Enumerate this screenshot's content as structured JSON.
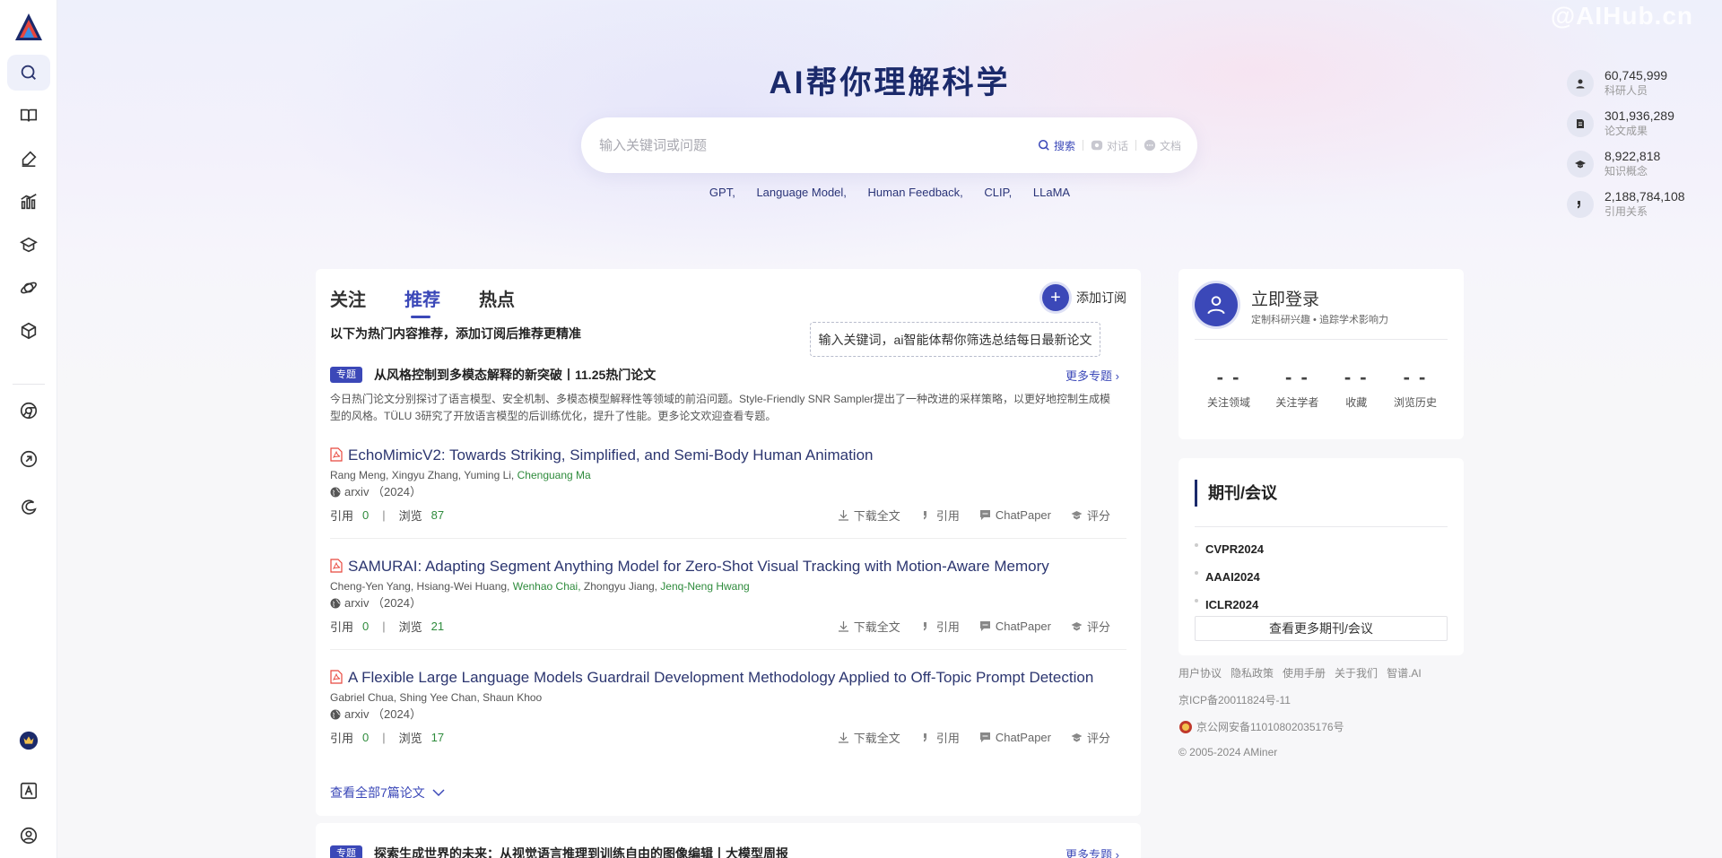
{
  "watermark": "@AIHub.cn",
  "hero": {
    "title": "AI帮你理解科学",
    "search_placeholder": "输入关键词或问题",
    "actions": [
      "搜索",
      "对话",
      "文档"
    ],
    "hot_tags": [
      "GPT,",
      "Language Model,",
      "Human Feedback,",
      "CLIP,",
      "LLaMA"
    ]
  },
  "stats": [
    {
      "value": "60,745,999",
      "label": "科研人员",
      "icon": "person-icon"
    },
    {
      "value": "301,936,289",
      "label": "论文成果",
      "icon": "document-icon"
    },
    {
      "value": "8,922,818",
      "label": "知识概念",
      "icon": "graduation-cap-icon"
    },
    {
      "value": "2,188,784,108",
      "label": "引用关系",
      "icon": "quote-icon"
    }
  ],
  "tabs": [
    "关注",
    "推荐",
    "热点"
  ],
  "active_tab": "推荐",
  "subscribe": {
    "label": "添加订阅",
    "tip": "输入关键词，ai智能体帮你筛选总结每日最新论文"
  },
  "hint": "以下为热门内容推荐，添加订阅后推荐更精准",
  "topic": {
    "badge": "专题",
    "title": "从风格控制到多模态解释的新突破丨11.25热门论文",
    "more": "更多专题",
    "desc": "今日热门论文分别探讨了语言模型、安全机制、多模态模型解释性等领域的前沿问题。Style-Friendly SNR Sampler提出了一种改进的采样策略，以更好地控制生成模型的风格。TÜLU 3研究了开放语言模型的后训练优化，提升了性能。更多论文欢迎查看专题。"
  },
  "paper_actions": [
    "下载全文",
    "引用",
    "ChatPaper",
    "评分"
  ],
  "meta_labels": {
    "cite": "引用",
    "views": "浏览"
  },
  "papers": [
    {
      "title": "EchoMimicV2: Towards Striking, Simplified, and Semi-Body Human Animation",
      "authors": [
        {
          "name": "Rang Meng,"
        },
        {
          "name": "Xingyu Zhang,"
        },
        {
          "name": "Yuming Li,"
        },
        {
          "name": "Chenguang Ma",
          "hl": true
        }
      ],
      "venue": "arxiv （2024）",
      "cites": "0",
      "views": "87"
    },
    {
      "title": "SAMURAI: Adapting Segment Anything Model for Zero-Shot Visual Tracking with Motion-Aware Memory",
      "authors": [
        {
          "name": "Cheng-Yen Yang,"
        },
        {
          "name": "Hsiang-Wei Huang,"
        },
        {
          "name": "Wenhao Chai,",
          "hl": true
        },
        {
          "name": "Zhongyu Jiang,"
        },
        {
          "name": "Jenq-Neng Hwang",
          "hl": true
        }
      ],
      "venue": "arxiv （2024）",
      "cites": "0",
      "views": "21"
    },
    {
      "title": "A Flexible Large Language Models Guardrail Development Methodology Applied to Off-Topic Prompt Detection",
      "authors": [
        {
          "name": "Gabriel Chua,"
        },
        {
          "name": "Shing Yee Chan,"
        },
        {
          "name": "Shaun Khoo"
        }
      ],
      "venue": "arxiv （2024）",
      "cites": "0",
      "views": "17"
    }
  ],
  "view_all": "查看全部7篇论文",
  "topic2": {
    "badge": "专题",
    "title": "探索生成世界的未来：从视觉语言推理到训练自由的图像编辑丨大模型周报",
    "more": "更多专题"
  },
  "login": {
    "title": "立即登录",
    "subtitle": "定制科研兴趣 • 追踪学术影响力",
    "stats": [
      {
        "value": "- -",
        "label": "关注领域"
      },
      {
        "value": "- -",
        "label": "关注学者"
      },
      {
        "value": "- -",
        "label": "收藏"
      },
      {
        "value": "- -",
        "label": "浏览历史"
      }
    ]
  },
  "conferences": {
    "title": "期刊/会议",
    "items": [
      "CVPR2024",
      "AAAI2024",
      "ICLR2024"
    ],
    "more": "查看更多期刊/会议"
  },
  "footer": {
    "links": [
      "用户协议",
      "隐私政策",
      "使用手册",
      "关于我们",
      "智谱.AI"
    ],
    "icp": "京ICP备20011824号-11",
    "police": "京公网安备11010802035176号",
    "copyright": "© 2005-2024 AMiner"
  },
  "colors": {
    "accent": "#3b48b8",
    "highlight": "#2e8b3c",
    "title": "#1b2a6b"
  }
}
